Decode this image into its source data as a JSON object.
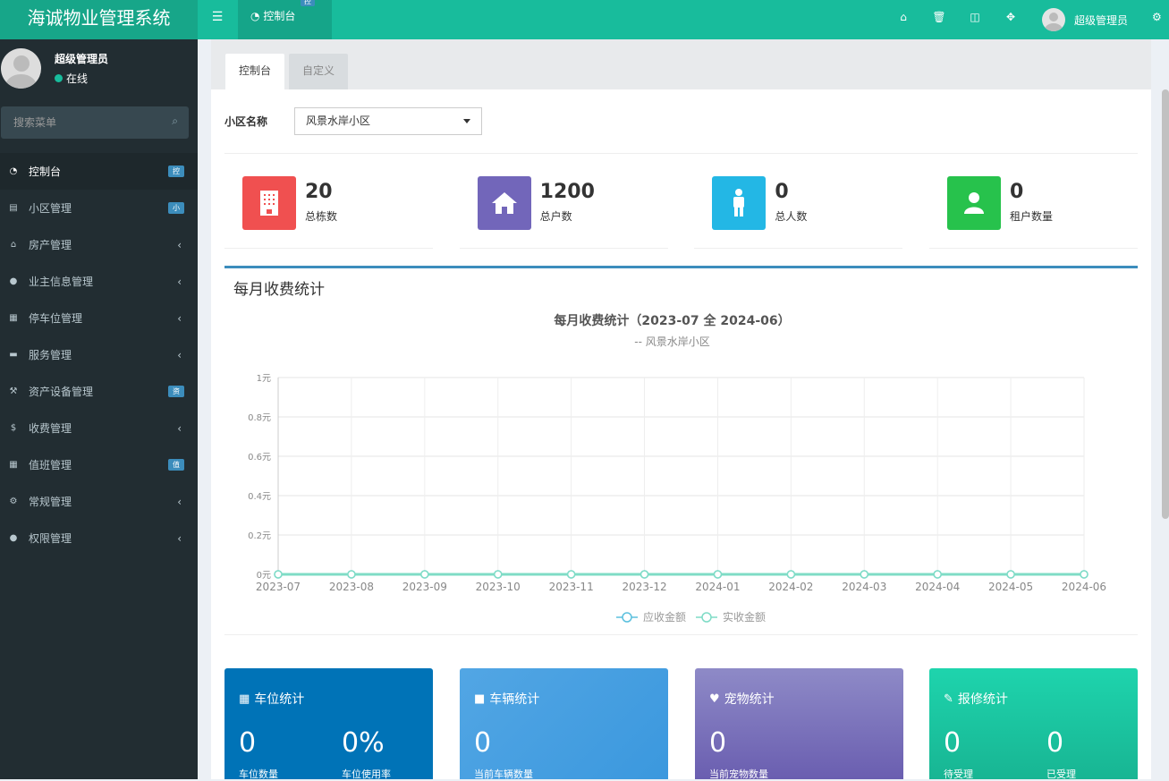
{
  "app": {
    "title": "海诚物业管理系统"
  },
  "topbar": {
    "tab_label": "控制台",
    "tab_badge": "控",
    "icons": [
      "home-icon",
      "trash-icon",
      "translate-icon",
      "fullscreen-icon"
    ],
    "user_name": "超级管理员"
  },
  "sidebar": {
    "user_name": "超级管理员",
    "status": "在线",
    "search_placeholder": "搜索菜单",
    "items": [
      {
        "label": "控制台",
        "badge": "控",
        "icon": "dashboard-icon"
      },
      {
        "label": "小区管理",
        "badge": "小",
        "icon": "list-icon"
      },
      {
        "label": "房产管理",
        "arrow": "‹",
        "icon": "home-icon"
      },
      {
        "label": "业主信息管理",
        "arrow": "‹",
        "icon": "user-icon"
      },
      {
        "label": "停车位管理",
        "arrow": "‹",
        "icon": "film-icon"
      },
      {
        "label": "服务管理",
        "arrow": "‹",
        "icon": "coffee-icon"
      },
      {
        "label": "资产设备管理",
        "badge": "资",
        "icon": "gavel-icon"
      },
      {
        "label": "收费管理",
        "arrow": "‹",
        "icon": "dollar-icon"
      },
      {
        "label": "值班管理",
        "badge": "值",
        "icon": "calendar-icon"
      },
      {
        "label": "常规管理",
        "arrow": "‹",
        "icon": "cogs-icon"
      },
      {
        "label": "权限管理",
        "arrow": "‹",
        "icon": "group-icon"
      }
    ]
  },
  "content": {
    "tabs": [
      "控制台",
      "自定义"
    ],
    "filter_label": "小区名称",
    "filter_value": "风景水岸小区",
    "stats": [
      {
        "value": "20",
        "label": "总栋数",
        "color": "#f05050"
      },
      {
        "value": "1200",
        "label": "总户数",
        "color": "#7266ba"
      },
      {
        "value": "0",
        "label": "总人数",
        "color": "#23b7e5"
      },
      {
        "value": "0",
        "label": "租户数量",
        "color": "#27c24c"
      }
    ],
    "chart_section_title": "每月收费统计",
    "cards": [
      {
        "title": "车位统计",
        "v1": "0",
        "l1": "车位数量",
        "v2": "0%",
        "l2": "车位使用率"
      },
      {
        "title": "车辆统计",
        "v1": "0",
        "l1": "当前车辆数量"
      },
      {
        "title": "宠物统计",
        "v1": "0",
        "l1": "当前宠物数量"
      },
      {
        "title": "报修统计",
        "v1": "0",
        "l1": "待受理",
        "v2": "0",
        "l2": "已受理"
      }
    ]
  },
  "chart_data": {
    "type": "line",
    "title": "每月收费统计（2023-07 全 2024-06）",
    "subtitle": "-- 风景水岸小区",
    "categories": [
      "2023-07",
      "2023-08",
      "2023-09",
      "2023-10",
      "2023-11",
      "2023-12",
      "2024-01",
      "2024-02",
      "2024-03",
      "2024-04",
      "2024-05",
      "2024-06"
    ],
    "yticks": [
      "0元",
      "0.2元",
      "0.4元",
      "0.6元",
      "0.8元",
      "1元"
    ],
    "ylim": [
      0,
      1
    ],
    "series": [
      {
        "name": "应收金额",
        "values": [
          0,
          0,
          0,
          0,
          0,
          0,
          0,
          0,
          0,
          0,
          0,
          0
        ],
        "color": "#5bc0de"
      },
      {
        "name": "实收金额",
        "values": [
          0,
          0,
          0,
          0,
          0,
          0,
          0,
          0,
          0,
          0,
          0,
          0
        ],
        "color": "#7fdcc6"
      }
    ],
    "grid": true,
    "legend": "bottom-center"
  }
}
